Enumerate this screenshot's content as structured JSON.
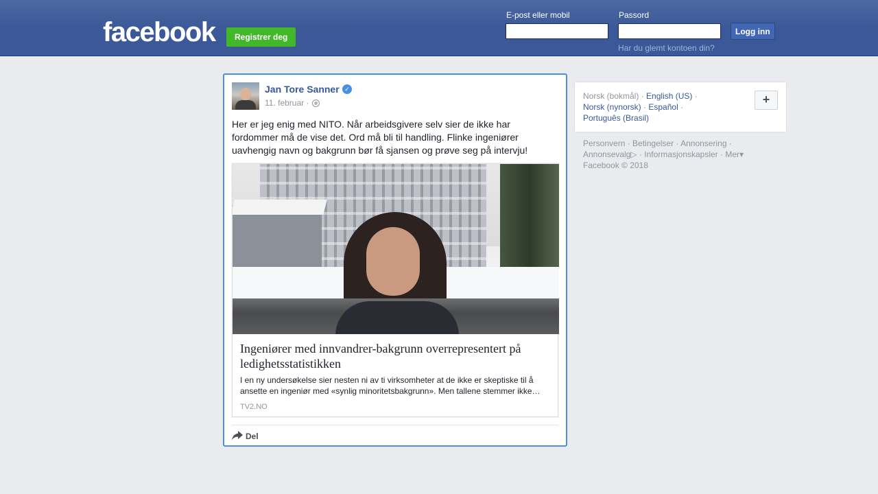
{
  "header": {
    "logo": "facebook",
    "register_label": "Registrer deg",
    "email_label": "E-post eller mobil",
    "password_label": "Passord",
    "login_label": "Logg inn",
    "forgot_label": "Har du glemt kontoen din?"
  },
  "post": {
    "author": "Jan Tore Sanner",
    "date": "11. februar",
    "separator": "·",
    "text": "Her er jeg enig med NITO. Når arbeidsgivere selv sier de ikke har fordommer må de vise det. Ord må bli til handling. Flinke ingeniører uavhengig navn og bakgrunn bør få sjansen og prøve seg på intervju!",
    "link": {
      "title": "Ingeniører med innvandrer-bakgrunn overrepresentert på ledighetsstatistikken",
      "description": "I en ny undersøkelse sier nesten ni av ti virksomheter at de ikke er skeptiske til å ansette en ingeniør med «synlig minoritetsbakgrunn». Men tallene stemmer ikke…",
      "source": "TV2.NO"
    },
    "share_label": "Del"
  },
  "sidebar": {
    "languages": {
      "current": "Norsk (bokmål)",
      "options": [
        "English (US)",
        "Norsk (nynorsk)",
        "Español",
        "Português (Brasil)"
      ],
      "separator": "·",
      "more_label": "+"
    },
    "footer": {
      "links": [
        "Personvern",
        "Betingelser",
        "Annonsering",
        "Annonsevalg",
        "Informasjonskapsler",
        "Mer"
      ],
      "copyright": "Facebook © 2018"
    }
  },
  "colors": {
    "brand_blue": "#3b5998",
    "green": "#42b72a",
    "link_blue": "#365899",
    "focus_border": "#4a90e2"
  }
}
